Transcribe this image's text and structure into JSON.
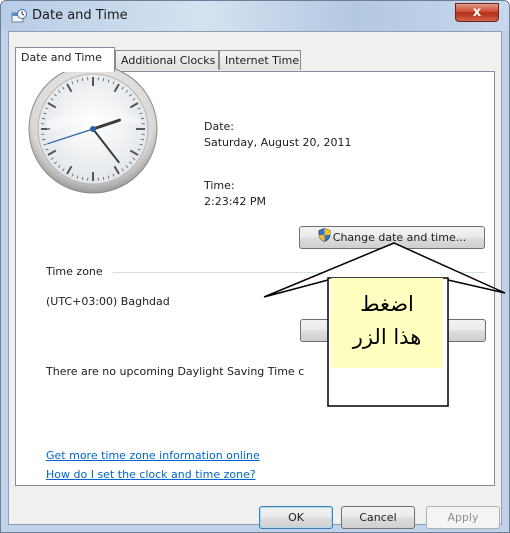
{
  "window": {
    "title": "Date and Time",
    "close_label": "x"
  },
  "tabs": [
    {
      "label": "Date and Time",
      "active": true
    },
    {
      "label": "Additional Clocks",
      "active": false
    },
    {
      "label": "Internet Time",
      "active": false
    }
  ],
  "datetime": {
    "date_label": "Date:",
    "date_value": "Saturday, August 20, 2011",
    "time_label": "Time:",
    "time_value": "2:23:42 PM",
    "change_button": "Change date and time..."
  },
  "timezone": {
    "section_label": "Time zone",
    "value": "(UTC+03:00) Baghdad",
    "dst_message": "There are no upcoming Daylight Saving Time c"
  },
  "links": {
    "more_info": "Get more time zone information online",
    "how_to": "How do I set the clock and time zone?"
  },
  "footer": {
    "ok": "OK",
    "cancel": "Cancel",
    "apply": "Apply"
  },
  "callout": {
    "line1": "اضغط",
    "line2": "هذا الزر",
    "fill": "#ffffc0"
  },
  "icons": {
    "title_icon": "clock-calendar-icon",
    "shield_icon": "uac-shield-icon"
  },
  "clock": {
    "hour": 2,
    "minute": 23,
    "second": 42
  }
}
